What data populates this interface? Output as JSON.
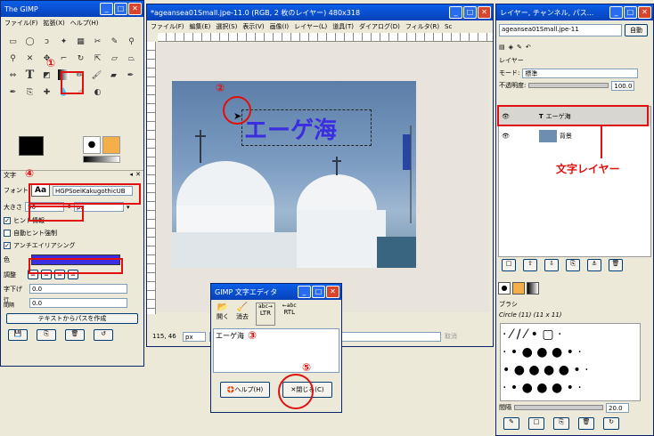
{
  "toolbox": {
    "title": "The GIMP",
    "menu": [
      "ファイル(F)",
      "拡張(X)",
      "ヘルプ(H)"
    ],
    "text_tool_icon": "T",
    "text_panel_title": "文字",
    "font_label": "フォント",
    "font_preview": "Aa",
    "font_value": "HGPSoeiKakugothicUB",
    "size_label": "大きさ",
    "size_value": "56",
    "unit_value": "px",
    "hinting_label": "ヒント情報",
    "autohint_label": "自動ヒント強制",
    "antialias_label": "アンチエイリアシング",
    "color_label": "色",
    "justify_label": "調整",
    "indent_label": "字下げ",
    "indent_value": "0.0",
    "spacing_label": "行\n間隔",
    "spacing_value": "0.0",
    "path_button": "テキストからパスを作成",
    "text_color": "#3a2ee0"
  },
  "image_window": {
    "title": "*ageansea01Small.jpe-11.0 (RGB, 2 枚のレイヤー) 480x318",
    "menu": [
      "ファイル(F)",
      "編集(E)",
      "選択(S)",
      "表示(V)",
      "画像(I)",
      "レイヤー(L)",
      "道具(T)",
      "ダイアログ(D)",
      "フィルタ(R)",
      "Sc"
    ],
    "canvas_text": "エーゲ海",
    "coords": "115, 46",
    "unit": "px",
    "cancel": "取消"
  },
  "layers_window": {
    "title": "レイヤー, チャンネル, パス...",
    "image_select": "ageansea01Small.jpe-11",
    "auto_button": "自動",
    "layers_label": "レイヤー",
    "mode_label": "モード:",
    "mode_value": "標準",
    "opacity_label": "不透明度:",
    "opacity_value": "100.0",
    "layers": [
      {
        "name": "エーゲ海"
      },
      {
        "name": "背景"
      }
    ],
    "annotation": "文字レイヤー",
    "brush_label": "ブラシ",
    "brush_name": "Circle (11) (11 x 11)",
    "spacing_label": "間隔",
    "spacing_value": "20.0"
  },
  "text_editor": {
    "title": "GIMP 文字エディタ",
    "open": "開く",
    "clear": "消去",
    "ltr": "LTR",
    "rtl": "RTL",
    "content": "エーゲ海",
    "help": "ヘルプ(H)",
    "close": "閉じる(C)"
  },
  "annotations": {
    "n1": "①",
    "n2": "②",
    "n3": "③",
    "n4": "④",
    "n5": "⑤"
  }
}
